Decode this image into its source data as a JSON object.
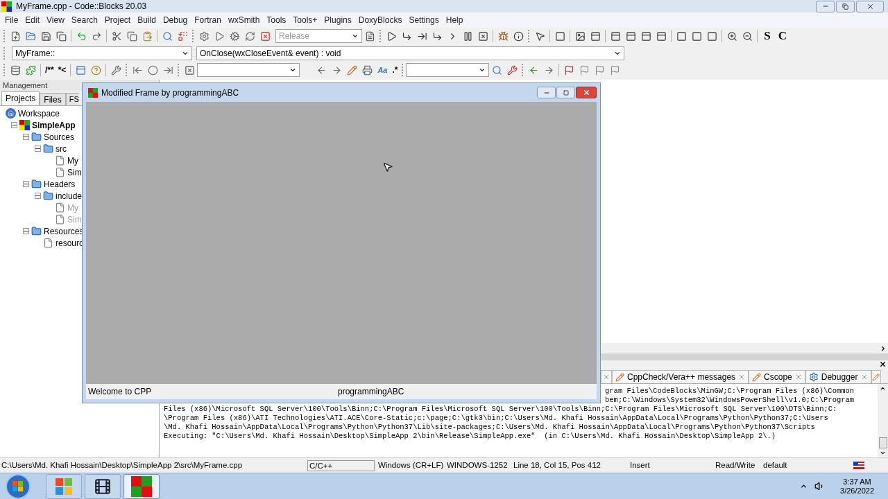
{
  "window": {
    "title": "MyFrame.cpp - Code::Blocks 20.03"
  },
  "menu": [
    "File",
    "Edit",
    "View",
    "Search",
    "Project",
    "Build",
    "Debug",
    "Fortran",
    "wxSmith",
    "Tools",
    "Tools+",
    "Plugins",
    "DoxyBlocks",
    "Settings",
    "Help"
  ],
  "toolbar": {
    "build_target": {
      "value": "Release",
      "disabled": true
    },
    "doc_comment_labels": [
      "/**",
      "*<"
    ],
    "case_label": "Aa",
    "regex_label": ".*",
    "wx_labels": [
      "S",
      "C"
    ]
  },
  "code_nav": {
    "scope": "MyFrame::",
    "function": "OnClose(wxCloseEvent& event) : void"
  },
  "management": {
    "title": "Management",
    "tabs": [
      {
        "label": "Projects",
        "selected": true
      },
      {
        "label": "Files",
        "selected": false
      },
      {
        "label": "FS",
        "selected": false
      }
    ],
    "tree": [
      {
        "label": "Workspace",
        "kind": "workspace",
        "children": [
          {
            "label": "SimpleApp",
            "kind": "project",
            "expanded": true,
            "children": [
              {
                "label": "Sources",
                "kind": "folder",
                "expanded": true,
                "children": [
                  {
                    "label": "src",
                    "kind": "folder",
                    "expanded": true,
                    "children": [
                      {
                        "label": "My",
                        "kind": "file",
                        "dimmed": false
                      },
                      {
                        "label": "Sim",
                        "kind": "file",
                        "dimmed": false
                      }
                    ]
                  }
                ]
              },
              {
                "label": "Headers",
                "kind": "folder",
                "expanded": true,
                "children": [
                  {
                    "label": "include",
                    "kind": "folder",
                    "expanded": true,
                    "children": [
                      {
                        "label": "My",
                        "kind": "file",
                        "dimmed": true
                      },
                      {
                        "label": "Sim",
                        "kind": "file",
                        "dimmed": true
                      }
                    ]
                  }
                ]
              },
              {
                "label": "Resources",
                "kind": "folder",
                "expanded": true,
                "children": [
                  {
                    "label": "resourc",
                    "kind": "file",
                    "dimmed": false
                  }
                ]
              }
            ]
          }
        ]
      }
    ]
  },
  "app_frame": {
    "title": "Modified Frame by programmingABC",
    "status": [
      "Welcome to CPP",
      "programmingABC"
    ]
  },
  "logs": {
    "tabs": [
      {
        "label": "CppCheck/Vera++ messages",
        "kind": "note"
      },
      {
        "label": "Cscope",
        "kind": "note"
      },
      {
        "label": "Debugger",
        "kind": "gear"
      }
    ],
    "lines": [
      {
        "text": "gram Files\\CodeBlocks\\MinGW;C:\\Program Files (x86)\\Common",
        "partly_hidden": true
      },
      {
        "text": "bem;C:\\Windows\\System32\\WindowsPowerShell\\v1.0;C:\\Program",
        "partly_hidden": true
      },
      {
        "text": "Files (x86)\\Microsoft SQL Server\\100\\Tools\\Binn;C:\\Program Files\\Microsoft SQL Server\\100\\Tools\\Binn;C:\\Program Files\\Microsoft SQL Server\\100\\DTS\\Binn;C:",
        "partly_hidden": false
      },
      {
        "text": "\\Program Files (x86)\\ATI Technologies\\ATI.ACE\\Core-Static;c:\\page;C:\\gtk3\\bin;C:\\Users\\Md. Khafi Hossain\\AppData\\Local\\Programs\\Python\\Python37;C:\\Users",
        "partly_hidden": false
      },
      {
        "text": "\\Md. Khafi Hossain\\AppData\\Local\\Programs\\Python\\Python37\\Lib\\site-packages;C:\\Users\\Md. Khafi Hossain\\AppData\\Local\\Programs\\Python\\Python37\\Scripts",
        "partly_hidden": false
      },
      {
        "text": "Executing: \"C:\\Users\\Md. Khafi Hossain\\Desktop\\SimpleApp 2\\bin\\Release\\SimpleApp.exe\"  (in C:\\Users\\Md. Khafi Hossain\\Desktop\\SimpleApp 2\\.)",
        "partly_hidden": false
      }
    ]
  },
  "status_bar": {
    "path": "C:\\Users\\Md. Khafi Hossain\\Desktop\\SimpleApp 2\\src\\MyFrame.cpp",
    "language": "C/C++",
    "line_endings": "Windows (CR+LF)",
    "encoding": "WINDOWS-1252",
    "position": "Line 18, Col 15, Pos 412",
    "mode": "Insert",
    "access": "Read/Write",
    "profile": "default"
  },
  "taskbar": {
    "apps": [
      {
        "kind": "explorer",
        "selected": false
      },
      {
        "kind": "media",
        "selected": false
      },
      {
        "kind": "codeblocks",
        "selected": true
      }
    ],
    "time": "3:37 AM",
    "date": "3/26/2022"
  }
}
